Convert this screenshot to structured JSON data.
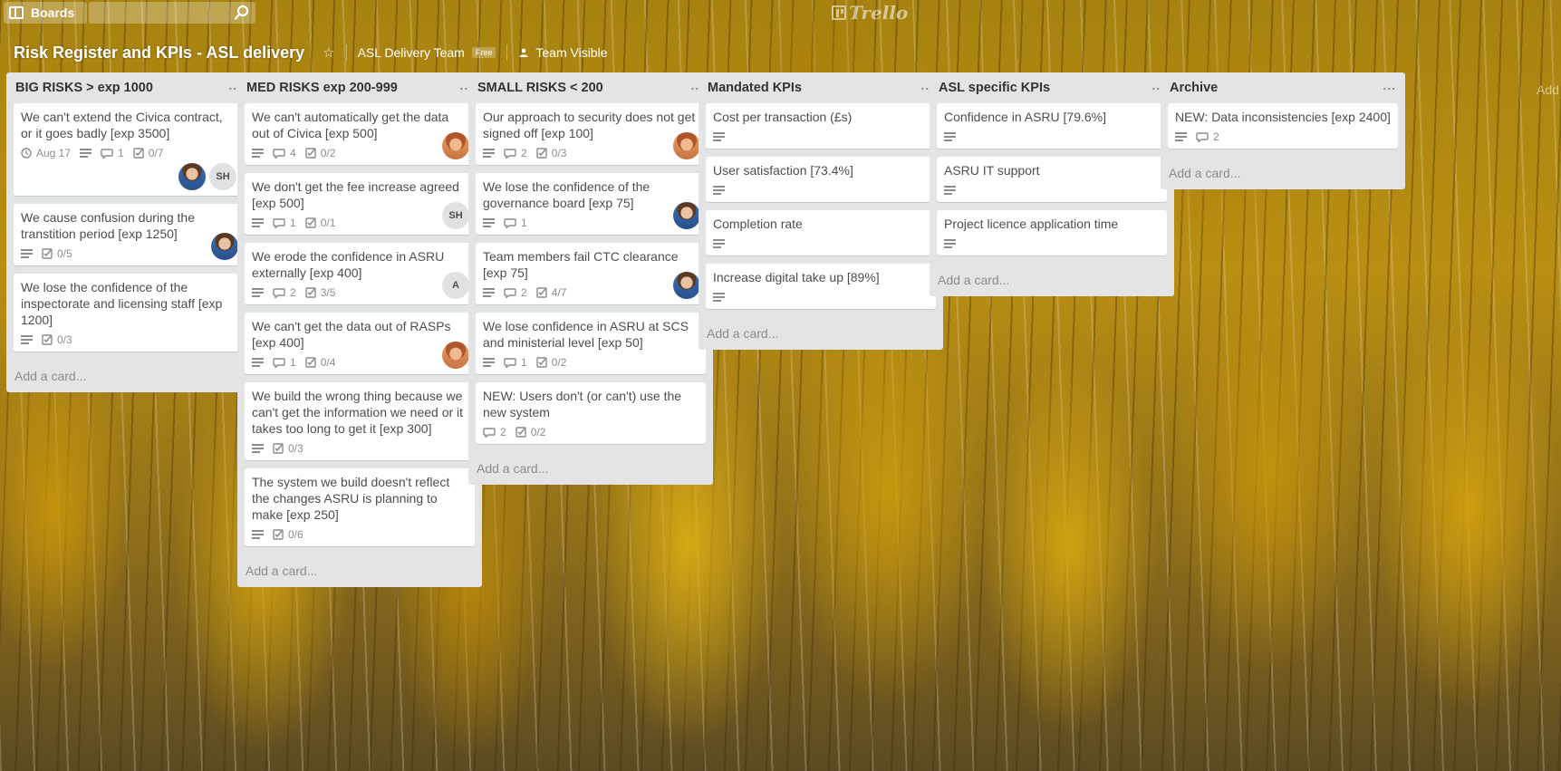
{
  "topbar": {
    "boards_label": "Boards",
    "logo_text": "Trello"
  },
  "board": {
    "title": "Risk Register and KPIs - ASL delivery",
    "team_name": "ASL Delivery Team",
    "team_badge": "Free",
    "visibility": "Team Visible"
  },
  "add_list_hint": "Add",
  "lists": [
    {
      "title": "BIG RISKS > exp 1000",
      "menu": "...",
      "add_card": "Add a card...",
      "cards": [
        {
          "title": "We can't extend the Civica contract, or it goes badly [exp 3500]",
          "due": "Aug 17",
          "comments": "1",
          "checklist": "0/7",
          "members": [
            "photo-a",
            "SH"
          ]
        },
        {
          "title": "We cause confusion during the transtition period [exp 1250]",
          "checklist": "0/5",
          "members": [
            "photo-a"
          ]
        },
        {
          "title": "We lose the confidence of the inspectorate and licensing staff [exp 1200]",
          "checklist": "0/3"
        }
      ]
    },
    {
      "title": "MED RISKS exp 200-999",
      "menu": "...",
      "add_card": "Add a card...",
      "cards": [
        {
          "title": "We can't automatically get the data out of Civica [exp 500]",
          "comments": "4",
          "checklist": "0/2",
          "members": [
            "photo-b"
          ]
        },
        {
          "title": "We don't get the fee increase agreed [exp 500]",
          "comments": "1",
          "checklist": "0/1",
          "members": [
            "SH"
          ]
        },
        {
          "title": "We erode the confidence in ASRU externally [exp 400]",
          "comments": "2",
          "checklist": "3/5",
          "members": [
            "A"
          ]
        },
        {
          "title": "We can't get the data out of RASPs [exp 400]",
          "comments": "1",
          "checklist": "0/4",
          "members": [
            "photo-b"
          ]
        },
        {
          "title": "We build the wrong thing because we can't get the information we need or it takes too long to get it [exp 300]",
          "checklist": "0/3"
        },
        {
          "title": "The system we build doesn't reflect the changes ASRU is planning to make [exp 250]",
          "checklist": "0/6"
        }
      ]
    },
    {
      "title": "SMALL RISKS < 200",
      "menu": "...",
      "add_card": "Add a card...",
      "cards": [
        {
          "title": "Our approach to security does not get signed off [exp 100]",
          "comments": "2",
          "checklist": "0/3",
          "members": [
            "photo-b"
          ]
        },
        {
          "title": "We lose the confidence of the governance board [exp 75]",
          "comments": "1",
          "members": [
            "photo-a"
          ]
        },
        {
          "title": "Team members fail CTC clearance [exp 75]",
          "comments": "2",
          "checklist": "4/7",
          "members": [
            "photo-a"
          ]
        },
        {
          "title": "We lose confidence in ASRU at SCS and ministerial level [exp 50]",
          "comments": "1",
          "checklist": "0/2"
        },
        {
          "title": "NEW: Users don't (or can't) use the new system",
          "nodesc": true,
          "comments": "2",
          "checklist": "0/2"
        }
      ]
    },
    {
      "title": "Mandated KPIs",
      "menu": "...",
      "add_card": "Add a card...",
      "cards": [
        {
          "title": "Cost per transaction (£s)"
        },
        {
          "title": "User satisfaction [73.4%]"
        },
        {
          "title": "Completion rate"
        },
        {
          "title": "Increase digital take up [89%]"
        }
      ]
    },
    {
      "title": "ASL specific KPIs",
      "menu": "...",
      "add_card": "Add a card...",
      "cards": [
        {
          "title": "Confidence in ASRU [79.6%]"
        },
        {
          "title": "ASRU IT support"
        },
        {
          "title": "Project licence application time"
        }
      ]
    },
    {
      "title": "Archive",
      "menu": "...",
      "add_card": "Add a card...",
      "cards": [
        {
          "title": "NEW: Data inconsistencies [exp 2400]",
          "comments": "2"
        }
      ]
    }
  ]
}
